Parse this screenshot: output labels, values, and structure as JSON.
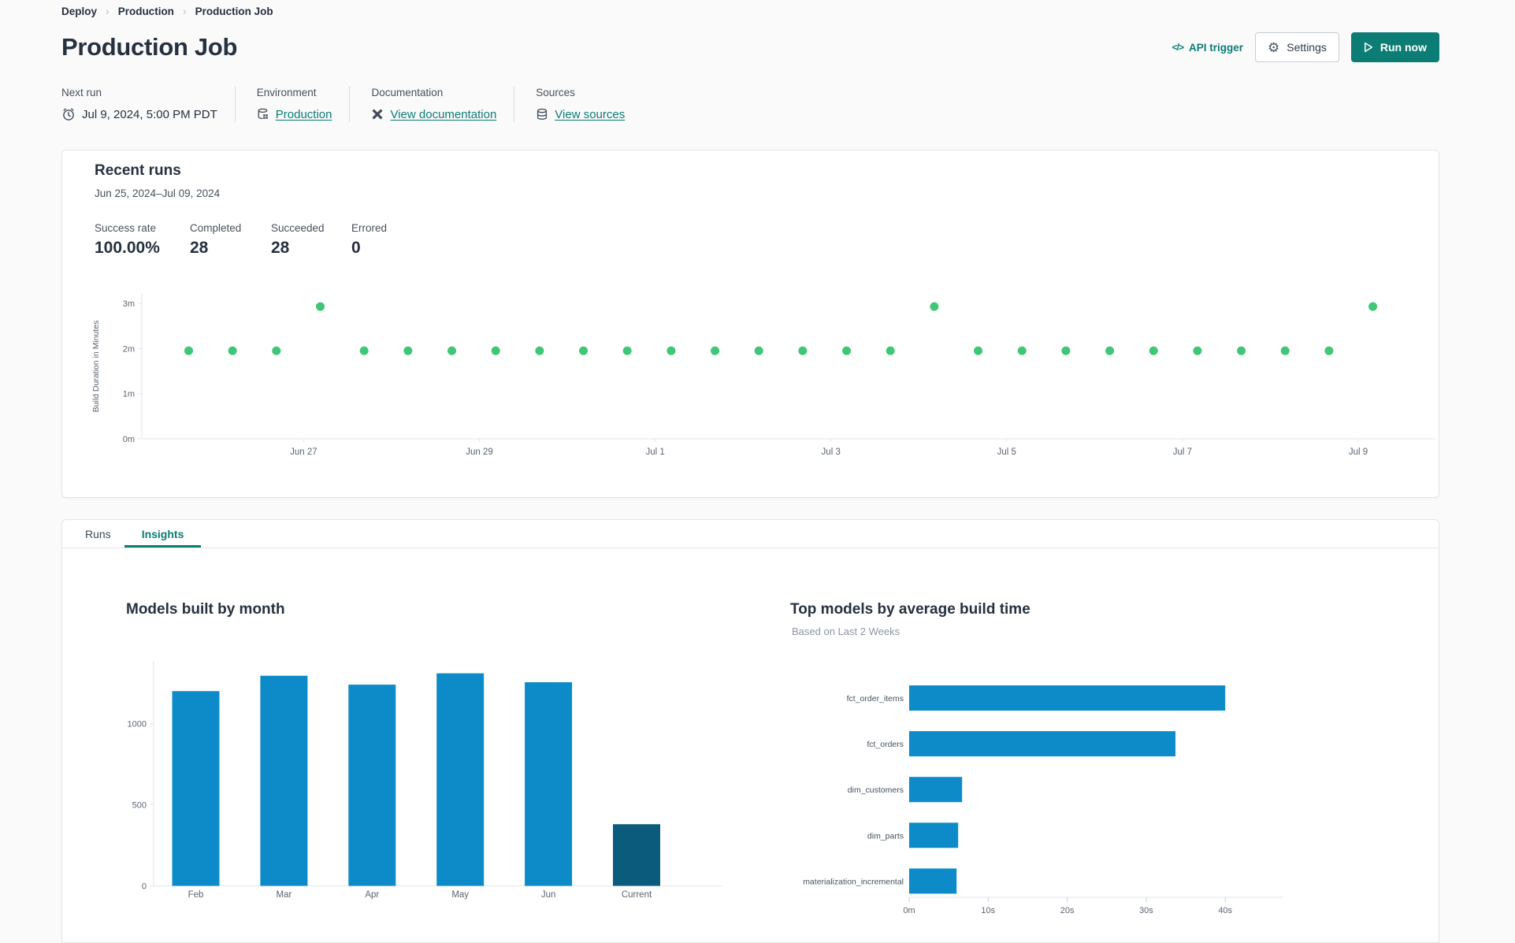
{
  "breadcrumb": {
    "separator": "›",
    "items": [
      "Deploy",
      "Production",
      "Production Job"
    ]
  },
  "header": {
    "title": "Production Job",
    "api_trigger_icon": "</>",
    "api_trigger_label": "API trigger",
    "settings_icon": "⚙",
    "settings_label": "Settings",
    "run_now_label": "Run now"
  },
  "info": {
    "next_run": {
      "label": "Next run",
      "value": "Jul 9, 2024, 5:00 PM PDT"
    },
    "environment": {
      "label": "Environment",
      "link": "Production"
    },
    "documentation": {
      "label": "Documentation",
      "link": "View documentation"
    },
    "sources": {
      "label": "Sources",
      "link": "View sources"
    }
  },
  "recent_runs": {
    "title": "Recent runs",
    "date_range": "Jun 25, 2024–Jul 09, 2024",
    "stats": [
      {
        "label": "Success rate",
        "value": "100.00%"
      },
      {
        "label": "Completed",
        "value": "28"
      },
      {
        "label": "Succeeded",
        "value": "28"
      },
      {
        "label": "Errored",
        "value": "0"
      }
    ]
  },
  "tabs": [
    {
      "label": "Runs",
      "active": false
    },
    {
      "label": "Insights",
      "active": true
    }
  ],
  "colors": {
    "accent_teal": "#0C7D74",
    "run_dot_green": "#3FC776",
    "bar_blue": "#0D8BC9",
    "bar_dark_blue": "#0B5C7C",
    "axis_line": "#E2E5E9",
    "tick_text": "#5A6472"
  },
  "chart_data": [
    {
      "id": "build-duration-scatter",
      "type": "scatter",
      "ylabel": "Build Duration in Minutes",
      "yticks": [
        0,
        1,
        2,
        3
      ],
      "ytick_labels": [
        "0m",
        "1m",
        "2m",
        "3m"
      ],
      "ylim": [
        0,
        3.2
      ],
      "xtick_labels": [
        "Jun 27",
        "Jun 29",
        "Jul 1",
        "Jul 3",
        "Jul 5",
        "Jul 7",
        "Jul 9"
      ],
      "point_color": "#3FC776",
      "points_minutes": [
        1.95,
        1.95,
        1.95,
        2.93,
        1.95,
        1.95,
        1.95,
        1.95,
        1.95,
        1.95,
        1.95,
        1.95,
        1.95,
        1.95,
        1.95,
        1.95,
        1.95,
        2.93,
        1.95,
        1.95,
        1.95,
        1.95,
        1.95,
        1.95,
        1.95,
        1.95,
        1.95,
        2.93
      ]
    },
    {
      "id": "models-built-by-month",
      "type": "bar",
      "title": "Models built by month",
      "categories": [
        "Feb",
        "Mar",
        "Apr",
        "May",
        "Jun",
        "Current"
      ],
      "values": [
        1200,
        1295,
        1240,
        1310,
        1255,
        380
      ],
      "yticks": [
        0,
        500,
        1000
      ],
      "ylim": [
        0,
        1350
      ],
      "bar_color": "#0D8BC9",
      "highlight_last_color": "#0B5C7C",
      "legend": "off",
      "grid": "off"
    },
    {
      "id": "top-models-by-average-build-time",
      "type": "bar-horizontal",
      "title": "Top models by average build time",
      "subtitle": "Based on Last 2 Weeks",
      "categories": [
        "fct_order_items",
        "fct_orders",
        "dim_customers",
        "dim_parts",
        "materialization_incremental"
      ],
      "values_seconds": [
        40.0,
        33.7,
        6.7,
        6.2,
        6.0
      ],
      "xticks_seconds": [
        0,
        10,
        20,
        30,
        40
      ],
      "xtick_labels": [
        "0m",
        "10s",
        "20s",
        "30s",
        "40s"
      ],
      "xlim_seconds": [
        0,
        45
      ],
      "bar_color": "#0D8BC9",
      "legend": "off",
      "grid": "off"
    }
  ]
}
